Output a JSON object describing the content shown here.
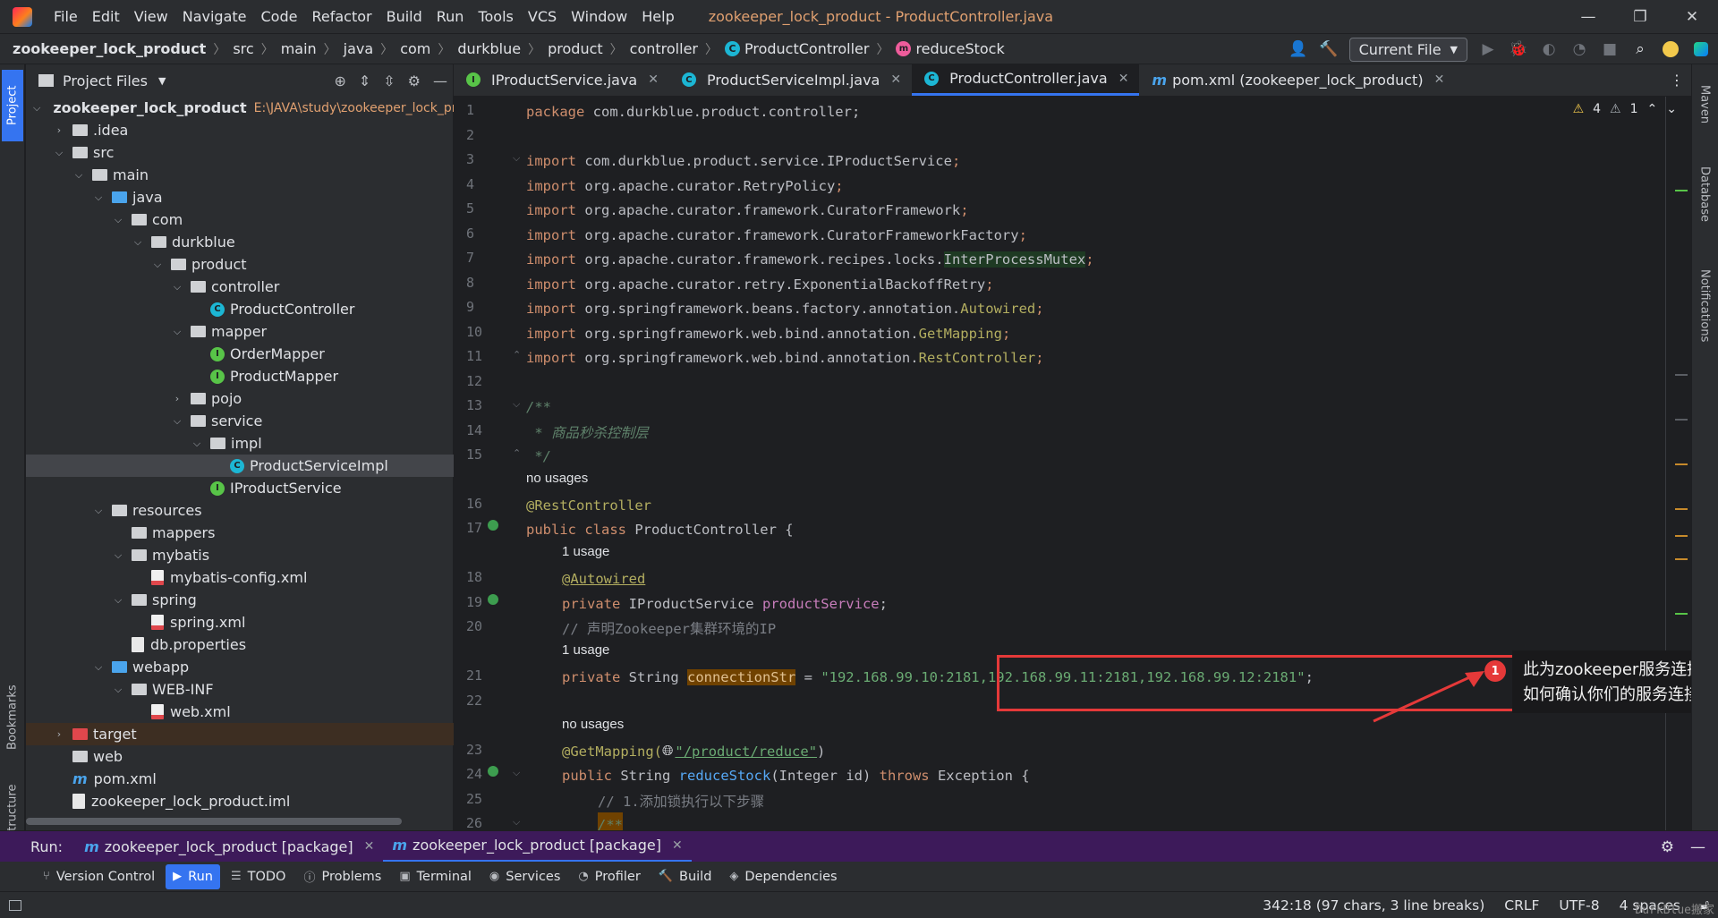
{
  "menubar": {
    "items": [
      "File",
      "Edit",
      "View",
      "Navigate",
      "Code",
      "Refactor",
      "Build",
      "Run",
      "Tools",
      "VCS",
      "Window",
      "Help"
    ],
    "window_title": "zookeeper_lock_product - ProductController.java"
  },
  "navbar": {
    "crumbs": [
      "zookeeper_lock_product",
      "src",
      "main",
      "java",
      "com",
      "durkblue",
      "product",
      "controller",
      "ProductController",
      "reduceStock"
    ],
    "run_config": "Current File"
  },
  "left_strip": {
    "project": "Project",
    "bookmarks": "Bookmarks",
    "structure": "Structure"
  },
  "right_strip": {
    "maven": "Maven",
    "database": "Database",
    "notifications": "Notifications"
  },
  "project": {
    "header": "Project Files",
    "tree": [
      {
        "label": "zookeeper_lock_product",
        "extra": "E:\\JAVA\\study\\zookeeper_lock_product",
        "icon": "module",
        "indent": 0,
        "chev": "open"
      },
      {
        "label": ".idea",
        "icon": "folder",
        "indent": 1,
        "chev": "closed"
      },
      {
        "label": "src",
        "icon": "folder",
        "indent": 1,
        "chev": "open"
      },
      {
        "label": "main",
        "icon": "folder",
        "indent": 2,
        "chev": "open"
      },
      {
        "label": "java",
        "icon": "folder-blue",
        "indent": 3,
        "chev": "open"
      },
      {
        "label": "com",
        "icon": "folder",
        "indent": 4,
        "chev": "open"
      },
      {
        "label": "durkblue",
        "icon": "folder",
        "indent": 5,
        "chev": "open"
      },
      {
        "label": "product",
        "icon": "folder",
        "indent": 6,
        "chev": "open"
      },
      {
        "label": "controller",
        "icon": "folder",
        "indent": 7,
        "chev": "open"
      },
      {
        "label": "ProductController",
        "icon": "class",
        "indent": 8,
        "chev": ""
      },
      {
        "label": "mapper",
        "icon": "folder",
        "indent": 7,
        "chev": "open"
      },
      {
        "label": "OrderMapper",
        "icon": "interface",
        "indent": 8,
        "chev": ""
      },
      {
        "label": "ProductMapper",
        "icon": "interface",
        "indent": 8,
        "chev": ""
      },
      {
        "label": "pojo",
        "icon": "folder",
        "indent": 7,
        "chev": "closed"
      },
      {
        "label": "service",
        "icon": "folder",
        "indent": 7,
        "chev": "open"
      },
      {
        "label": "impl",
        "icon": "folder",
        "indent": 8,
        "chev": "open"
      },
      {
        "label": "ProductServiceImpl",
        "icon": "class",
        "indent": 9,
        "chev": "",
        "selected": true
      },
      {
        "label": "IProductService",
        "icon": "interface",
        "indent": 8,
        "chev": ""
      },
      {
        "label": "resources",
        "icon": "folder",
        "indent": 3,
        "chev": "open"
      },
      {
        "label": "mappers",
        "icon": "folder",
        "indent": 4,
        "chev": ""
      },
      {
        "label": "mybatis",
        "icon": "folder",
        "indent": 4,
        "chev": "open"
      },
      {
        "label": "mybatis-config.xml",
        "icon": "xml",
        "indent": 5,
        "chev": ""
      },
      {
        "label": "spring",
        "icon": "folder",
        "indent": 4,
        "chev": "open"
      },
      {
        "label": "spring.xml",
        "icon": "xml",
        "indent": 5,
        "chev": ""
      },
      {
        "label": "db.properties",
        "icon": "file",
        "indent": 4,
        "chev": ""
      },
      {
        "label": "webapp",
        "icon": "folder-blue",
        "indent": 3,
        "chev": "open"
      },
      {
        "label": "WEB-INF",
        "icon": "folder",
        "indent": 4,
        "chev": "open"
      },
      {
        "label": "web.xml",
        "icon": "xml",
        "indent": 5,
        "chev": ""
      },
      {
        "label": "target",
        "icon": "folder-red",
        "indent": 1,
        "chev": "closed",
        "highlight": true
      },
      {
        "label": "web",
        "icon": "folder",
        "indent": 1,
        "chev": ""
      },
      {
        "label": "pom.xml",
        "icon": "maven",
        "indent": 1,
        "chev": ""
      },
      {
        "label": "zookeeper_lock_product.iml",
        "icon": "file",
        "indent": 1,
        "chev": ""
      }
    ]
  },
  "tabs": [
    {
      "label": "IProductService.java",
      "icon": "I"
    },
    {
      "label": "ProductServiceImpl.java",
      "icon": "C"
    },
    {
      "label": "ProductController.java",
      "icon": "C",
      "active": true
    },
    {
      "label": "pom.xml (zookeeper_lock_product)",
      "icon": "m"
    }
  ],
  "inspections": {
    "warnings": "4",
    "weak": "1"
  },
  "code": {
    "l1": "com.durkblue.product.controller",
    "l3": "com.durkblue.product.service.IProductService",
    "l4": "org.apache.curator.RetryPolicy",
    "l5": "org.apache.curator.framework.CuratorFramework",
    "l6": "org.apache.curator.framework.CuratorFrameworkFactory",
    "l7a": "org.apache.curator.framework.recipes.locks.",
    "l7b": "InterProcessMutex",
    "l8": "org.apache.curator.retry.ExponentialBackoffRetry",
    "l9a": "org.springframework.beans.factory.annotation.",
    "l9b": "Autowired",
    "l10a": "org.springframework.web.bind.annotation.",
    "l10b": "GetMapping",
    "l11a": "org.springframework.web.bind.annotation.",
    "l11b": "RestController",
    "l13": "/**",
    "l14": " * 商品秒杀控制层",
    "l15": " */",
    "hint_no_usages_1": "no usages",
    "l16": "@RestController",
    "l17a": "public class ",
    "l17b": "ProductController {",
    "hint_1_usage_1": "1 usage",
    "l18": "@Autowired",
    "l19a": "private ",
    "l19b": "IProductService ",
    "l19c": "productService",
    "l20": "// 声明Zookeeper集群环境的IP",
    "hint_1_usage_2": "1 usage",
    "l21a": "private ",
    "l21b": "String ",
    "l21c": "connectionStr",
    "l21d": " = ",
    "l21e": "\"192.168.99.10:2181,192.168.99.11:2181,192.168.99.12:2181\"",
    "hint_no_usages_2": "no usages",
    "l23a": "@GetMapping(",
    "l23b": "\"/product/reduce\"",
    "l23c": ")",
    "l24a": "public ",
    "l24b": "String ",
    "l24c": "reduceStock",
    "l24d": "(Integer id) ",
    "l24e": "throws ",
    "l24f": "Exception {",
    "l25": "// 1.添加锁执行以下步骤",
    "l26": "/**"
  },
  "annotation": {
    "badge": "1",
    "text_line1": "此为zookeeper服务连接地址。我在这里设置为了属性",
    "text_line2": "如何确认你们的服务连接地址。往下看",
    "color": "#e53939"
  },
  "run_bar": {
    "label": "Run:",
    "tabs": [
      "zookeeper_lock_product [package]",
      "zookeeper_lock_product [package]"
    ]
  },
  "bottom_tools": [
    "Version Control",
    "Run",
    "TODO",
    "Problems",
    "Terminal",
    "Services",
    "Profiler",
    "Build",
    "Dependencies"
  ],
  "status": {
    "position": "342:18 (97 chars, 3 line breaks)",
    "line_sep": "CRLF",
    "encoding": "UTF-8",
    "indent": "4 spaces"
  },
  "watermark": "DurkBlue搬家"
}
